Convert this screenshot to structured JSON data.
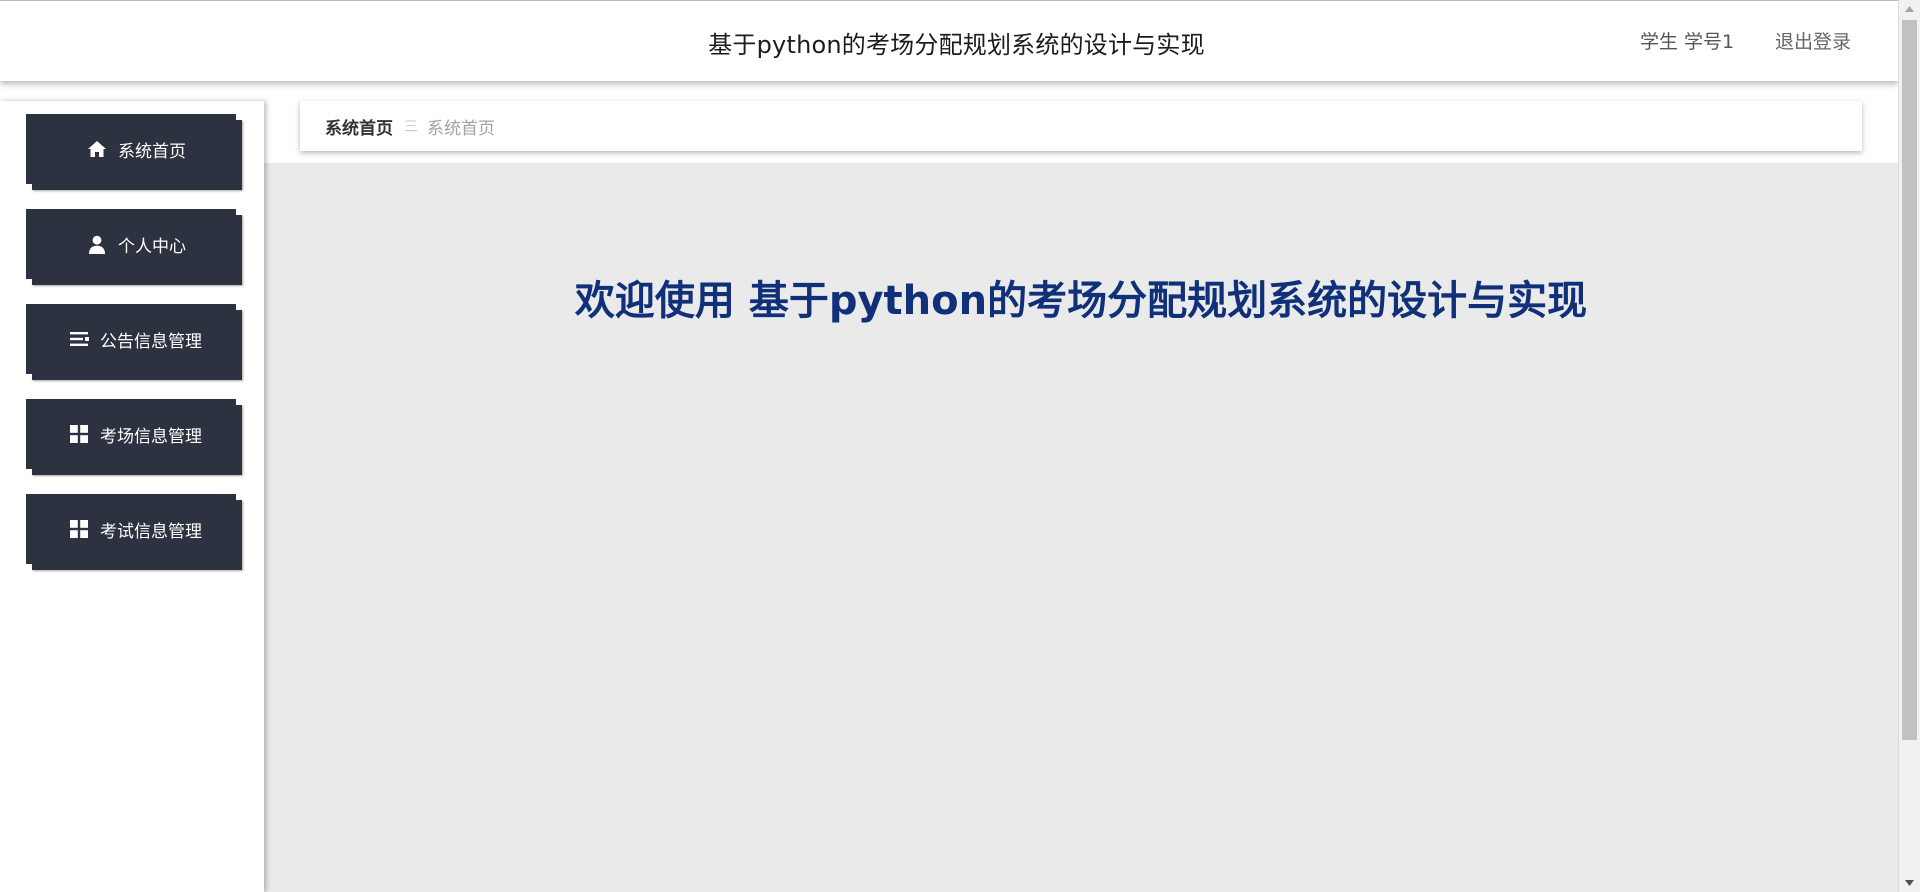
{
  "header": {
    "title": "基于python的考场分配规划系统的设计与实现",
    "user": "学生 学号1",
    "logout": "退出登录"
  },
  "sidebar": {
    "items": [
      {
        "label": "系统首页",
        "icon": "home-icon"
      },
      {
        "label": "个人中心",
        "icon": "user-icon"
      },
      {
        "label": "公告信息管理",
        "icon": "list-icon"
      },
      {
        "label": "考场信息管理",
        "icon": "grid-icon"
      },
      {
        "label": "考试信息管理",
        "icon": "grid-icon"
      }
    ]
  },
  "breadcrumb": {
    "home": "系统首页",
    "separator": "三",
    "current": "系统首页"
  },
  "main": {
    "welcome": "欢迎使用 基于python的考场分配规划系统的设计与实现"
  },
  "colors": {
    "sidebar_button": "#2d3240",
    "welcome_text": "#11307a",
    "content_bg": "#eaeaeb"
  }
}
